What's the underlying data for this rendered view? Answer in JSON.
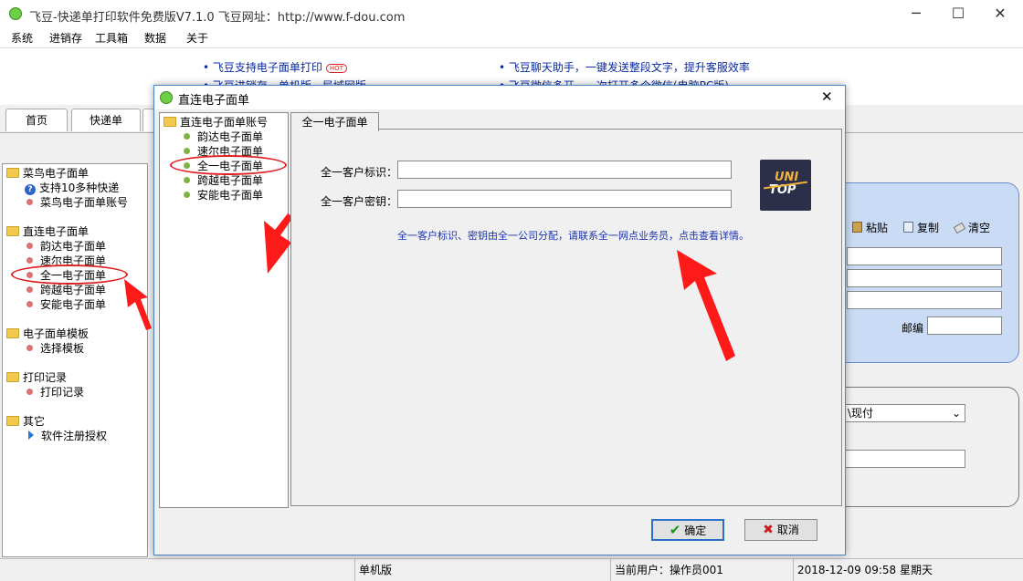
{
  "window": {
    "title": "飞豆-快递单打印软件免费版V7.1.0  飞豆网址：http://www.f-dou.com",
    "minimize": "─",
    "maximize": "☐",
    "close": "✕"
  },
  "menu": [
    "系统",
    "进销存",
    "工具箱",
    "数据",
    "关于"
  ],
  "banner": {
    "left": [
      "飞豆支持电子面单打印",
      "飞豆进销存，单机版，局域网版"
    ],
    "hot": "HOT",
    "right": [
      "飞豆聊天助手，一键发送整段文字，提升客服效率",
      "飞豆微信多开，一次打开多个微信(电脑PC版)"
    ]
  },
  "tabs": [
    "首页",
    "快递单"
  ],
  "sidebar": {
    "groups": [
      {
        "label": "菜鸟电子面单",
        "items": [
          "支持10多种快递",
          "菜鸟电子面单账号"
        ]
      },
      {
        "label": "直连电子面单",
        "items": [
          "韵达电子面单",
          "速尔电子面单",
          "全一电子面单",
          "跨越电子面单",
          "安能电子面单"
        ]
      },
      {
        "label": "电子面单模板",
        "items": [
          "选择模板"
        ]
      },
      {
        "label": "打印记录",
        "items": [
          "打印记录"
        ]
      },
      {
        "label": "其它",
        "items": [
          "软件注册授权"
        ]
      }
    ]
  },
  "background": {
    "paste": "粘贴",
    "copy": "复制",
    "clear": "清空",
    "zip_label": "邮编",
    "payment_select": "\\现付"
  },
  "statusbar": {
    "mode": "单机版",
    "user": "当前用户：操作员001",
    "datetime": "2018-12-09  09:58  星期天"
  },
  "dialog": {
    "title": "直连电子面单",
    "close": "✕",
    "tree_root": "直连电子面单账号",
    "tree_items": [
      "韵达电子面单",
      "速尔电子面单",
      "全一电子面单",
      "跨越电子面单",
      "安能电子面单"
    ],
    "tab": "全一电子面单",
    "id_label": "全一客户标识：",
    "id_value": "",
    "key_label": "全一客户密钥：",
    "key_value": "",
    "logo_top": "UNI",
    "logo_bottom": "TOP",
    "hint": "全一客户标识、密钥由全一公司分配，请联系全一网点业务员，点击查看详情。",
    "ok": "确定",
    "cancel": "取消"
  },
  "colors": {
    "link_blue": "#0a2aa0",
    "panel_blue": "#c9dbf5",
    "highlight_red": "#e02020"
  }
}
